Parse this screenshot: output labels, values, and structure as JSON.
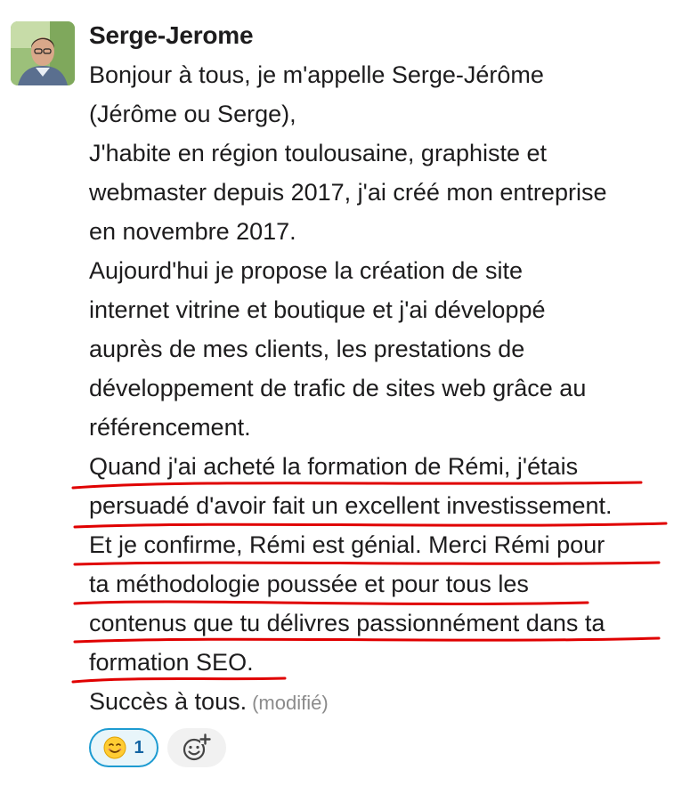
{
  "message": {
    "author": "Serge-Jerome",
    "lines": [
      "Bonjour à tous, je m'appelle Serge-Jérôme",
      "(Jérôme ou Serge),",
      "J'habite en région toulousaine, graphiste et",
      "webmaster depuis 2017, j'ai créé mon entreprise",
      "en novembre 2017.",
      "Aujourd'hui je propose la création de site",
      "internet vitrine et boutique et j'ai développé",
      "auprès de mes clients, les prestations de",
      "développement de trafic de sites web grâce au",
      "référencement.",
      "Quand j'ai acheté la formation de Rémi, j'étais",
      "persuadé d'avoir fait un excellent investissement.",
      "Et je confirme, Rémi est génial. Merci Rémi pour",
      "ta méthodologie poussée et pour tous les",
      "contenus que tu délivres passionnément dans ta",
      "formation SEO.",
      "Succès à tous."
    ],
    "edited_label": "(modifié)"
  },
  "reactions": [
    {
      "emoji": "smiling-face-emoji",
      "count": "1"
    }
  ],
  "add_reaction_icon": "add-reaction-icon",
  "colors": {
    "underline": "#e00000",
    "reaction_border": "#1d9bd1",
    "reaction_bg": "#e8f5fa",
    "reaction_count": "#1264a3",
    "text": "#1d1c1d",
    "muted": "#8b8b8b"
  }
}
